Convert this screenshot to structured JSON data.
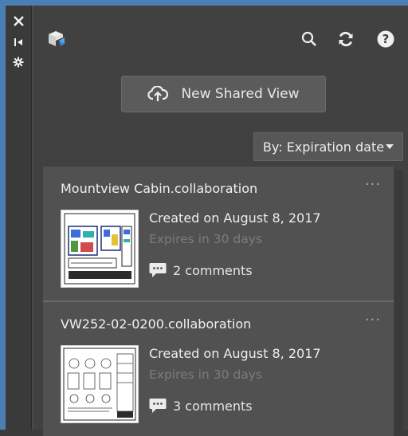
{
  "toolstrip": {
    "icons": [
      "close-icon",
      "dock-pin-icon",
      "settings-icon"
    ]
  },
  "header": {
    "logo_icon": "shared-views-cube-icon",
    "actions": [
      "search-icon",
      "refresh-icon",
      "help-icon"
    ],
    "help_glyph": "?"
  },
  "new_view": {
    "label": "New Shared View",
    "icon": "cloud-upload-icon"
  },
  "sort": {
    "label": "By: Expiration date"
  },
  "colors": {
    "accent_frame": "#4b7fb4",
    "panel": "#414141",
    "card": "#515151"
  },
  "views": [
    {
      "title": "Mountview Cabin.collaboration",
      "created": "Created on August 8, 2017",
      "expires": "Expires in 30 days",
      "comments": "2 comments",
      "more": "···"
    },
    {
      "title": "VW252-02-0200.collaboration",
      "created": "Created on August 8, 2017",
      "expires": "Expires in 30 days",
      "comments": "3 comments",
      "more": "···"
    }
  ]
}
